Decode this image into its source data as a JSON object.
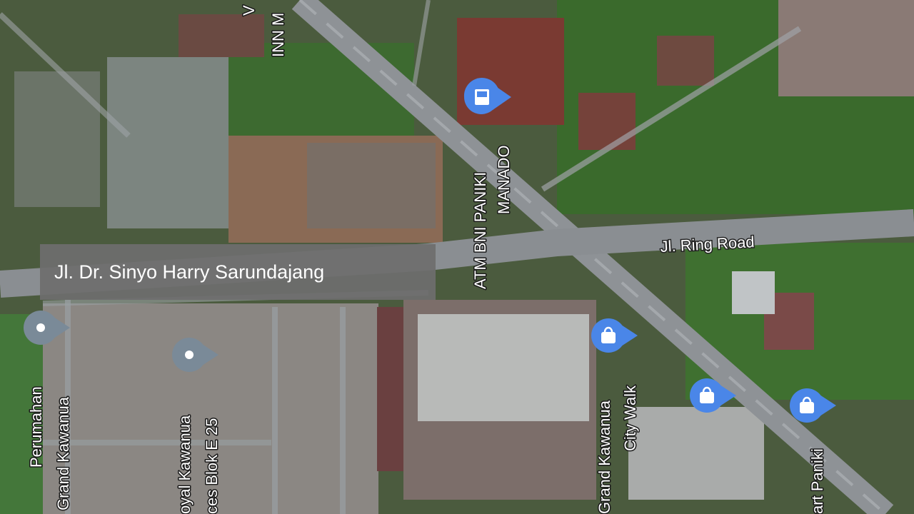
{
  "street_chip": {
    "text": "Jl. Dr. Sinyo Harry Sarundajang"
  },
  "road_labels": {
    "ring_road": "Jl. Ring Road"
  },
  "poi": {
    "atm": {
      "name_line1": "ATM BNI PANIKI",
      "name_line2": "MANADO",
      "icon": "atm-icon",
      "color": "#4a86e8"
    },
    "inn": {
      "name_line1": "V",
      "name_line2": "INN M",
      "icon": "pin-icon"
    },
    "perumahan": {
      "name_line1": "Perumahan",
      "name_line2": "Grand Kawanua",
      "icon": "pin-icon",
      "color": "#7a8a98"
    },
    "royal": {
      "name_line1": "oyal Kawanua",
      "name_line2": "ces Blok E 25",
      "icon": "pin-icon",
      "color": "#7a8a98"
    },
    "citywalk": {
      "name_line1": "Grand Kawanua",
      "name_line2": "City Walk",
      "icon": "shopping-bag-icon",
      "color": "#4a86e8"
    },
    "mall2": {
      "icon": "shopping-bag-icon",
      "color": "#4a86e8"
    },
    "paniki": {
      "name_line1": "art Paniki",
      "icon": "shopping-bag-icon",
      "color": "#4a86e8"
    }
  },
  "colors": {
    "vegetation": "#3d6b2e",
    "road": "#8e9296",
    "roof_red": "#7a3a32",
    "roof_grey": "#b5b7b5"
  }
}
